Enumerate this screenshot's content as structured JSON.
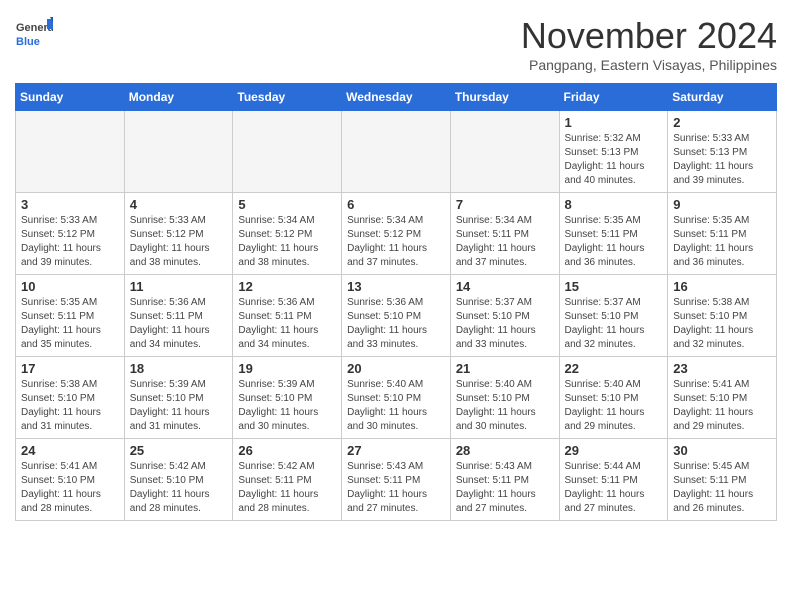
{
  "header": {
    "logo_general": "General",
    "logo_blue": "Blue",
    "month": "November 2024",
    "location": "Pangpang, Eastern Visayas, Philippines"
  },
  "weekdays": [
    "Sunday",
    "Monday",
    "Tuesday",
    "Wednesday",
    "Thursday",
    "Friday",
    "Saturday"
  ],
  "weeks": [
    [
      {
        "day": "",
        "info": ""
      },
      {
        "day": "",
        "info": ""
      },
      {
        "day": "",
        "info": ""
      },
      {
        "day": "",
        "info": ""
      },
      {
        "day": "",
        "info": ""
      },
      {
        "day": "1",
        "info": "Sunrise: 5:32 AM\nSunset: 5:13 PM\nDaylight: 11 hours\nand 40 minutes."
      },
      {
        "day": "2",
        "info": "Sunrise: 5:33 AM\nSunset: 5:13 PM\nDaylight: 11 hours\nand 39 minutes."
      }
    ],
    [
      {
        "day": "3",
        "info": "Sunrise: 5:33 AM\nSunset: 5:12 PM\nDaylight: 11 hours\nand 39 minutes."
      },
      {
        "day": "4",
        "info": "Sunrise: 5:33 AM\nSunset: 5:12 PM\nDaylight: 11 hours\nand 38 minutes."
      },
      {
        "day": "5",
        "info": "Sunrise: 5:34 AM\nSunset: 5:12 PM\nDaylight: 11 hours\nand 38 minutes."
      },
      {
        "day": "6",
        "info": "Sunrise: 5:34 AM\nSunset: 5:12 PM\nDaylight: 11 hours\nand 37 minutes."
      },
      {
        "day": "7",
        "info": "Sunrise: 5:34 AM\nSunset: 5:11 PM\nDaylight: 11 hours\nand 37 minutes."
      },
      {
        "day": "8",
        "info": "Sunrise: 5:35 AM\nSunset: 5:11 PM\nDaylight: 11 hours\nand 36 minutes."
      },
      {
        "day": "9",
        "info": "Sunrise: 5:35 AM\nSunset: 5:11 PM\nDaylight: 11 hours\nand 36 minutes."
      }
    ],
    [
      {
        "day": "10",
        "info": "Sunrise: 5:35 AM\nSunset: 5:11 PM\nDaylight: 11 hours\nand 35 minutes."
      },
      {
        "day": "11",
        "info": "Sunrise: 5:36 AM\nSunset: 5:11 PM\nDaylight: 11 hours\nand 34 minutes."
      },
      {
        "day": "12",
        "info": "Sunrise: 5:36 AM\nSunset: 5:11 PM\nDaylight: 11 hours\nand 34 minutes."
      },
      {
        "day": "13",
        "info": "Sunrise: 5:36 AM\nSunset: 5:10 PM\nDaylight: 11 hours\nand 33 minutes."
      },
      {
        "day": "14",
        "info": "Sunrise: 5:37 AM\nSunset: 5:10 PM\nDaylight: 11 hours\nand 33 minutes."
      },
      {
        "day": "15",
        "info": "Sunrise: 5:37 AM\nSunset: 5:10 PM\nDaylight: 11 hours\nand 32 minutes."
      },
      {
        "day": "16",
        "info": "Sunrise: 5:38 AM\nSunset: 5:10 PM\nDaylight: 11 hours\nand 32 minutes."
      }
    ],
    [
      {
        "day": "17",
        "info": "Sunrise: 5:38 AM\nSunset: 5:10 PM\nDaylight: 11 hours\nand 31 minutes."
      },
      {
        "day": "18",
        "info": "Sunrise: 5:39 AM\nSunset: 5:10 PM\nDaylight: 11 hours\nand 31 minutes."
      },
      {
        "day": "19",
        "info": "Sunrise: 5:39 AM\nSunset: 5:10 PM\nDaylight: 11 hours\nand 30 minutes."
      },
      {
        "day": "20",
        "info": "Sunrise: 5:40 AM\nSunset: 5:10 PM\nDaylight: 11 hours\nand 30 minutes."
      },
      {
        "day": "21",
        "info": "Sunrise: 5:40 AM\nSunset: 5:10 PM\nDaylight: 11 hours\nand 30 minutes."
      },
      {
        "day": "22",
        "info": "Sunrise: 5:40 AM\nSunset: 5:10 PM\nDaylight: 11 hours\nand 29 minutes."
      },
      {
        "day": "23",
        "info": "Sunrise: 5:41 AM\nSunset: 5:10 PM\nDaylight: 11 hours\nand 29 minutes."
      }
    ],
    [
      {
        "day": "24",
        "info": "Sunrise: 5:41 AM\nSunset: 5:10 PM\nDaylight: 11 hours\nand 28 minutes."
      },
      {
        "day": "25",
        "info": "Sunrise: 5:42 AM\nSunset: 5:10 PM\nDaylight: 11 hours\nand 28 minutes."
      },
      {
        "day": "26",
        "info": "Sunrise: 5:42 AM\nSunset: 5:11 PM\nDaylight: 11 hours\nand 28 minutes."
      },
      {
        "day": "27",
        "info": "Sunrise: 5:43 AM\nSunset: 5:11 PM\nDaylight: 11 hours\nand 27 minutes."
      },
      {
        "day": "28",
        "info": "Sunrise: 5:43 AM\nSunset: 5:11 PM\nDaylight: 11 hours\nand 27 minutes."
      },
      {
        "day": "29",
        "info": "Sunrise: 5:44 AM\nSunset: 5:11 PM\nDaylight: 11 hours\nand 27 minutes."
      },
      {
        "day": "30",
        "info": "Sunrise: 5:45 AM\nSunset: 5:11 PM\nDaylight: 11 hours\nand 26 minutes."
      }
    ]
  ]
}
